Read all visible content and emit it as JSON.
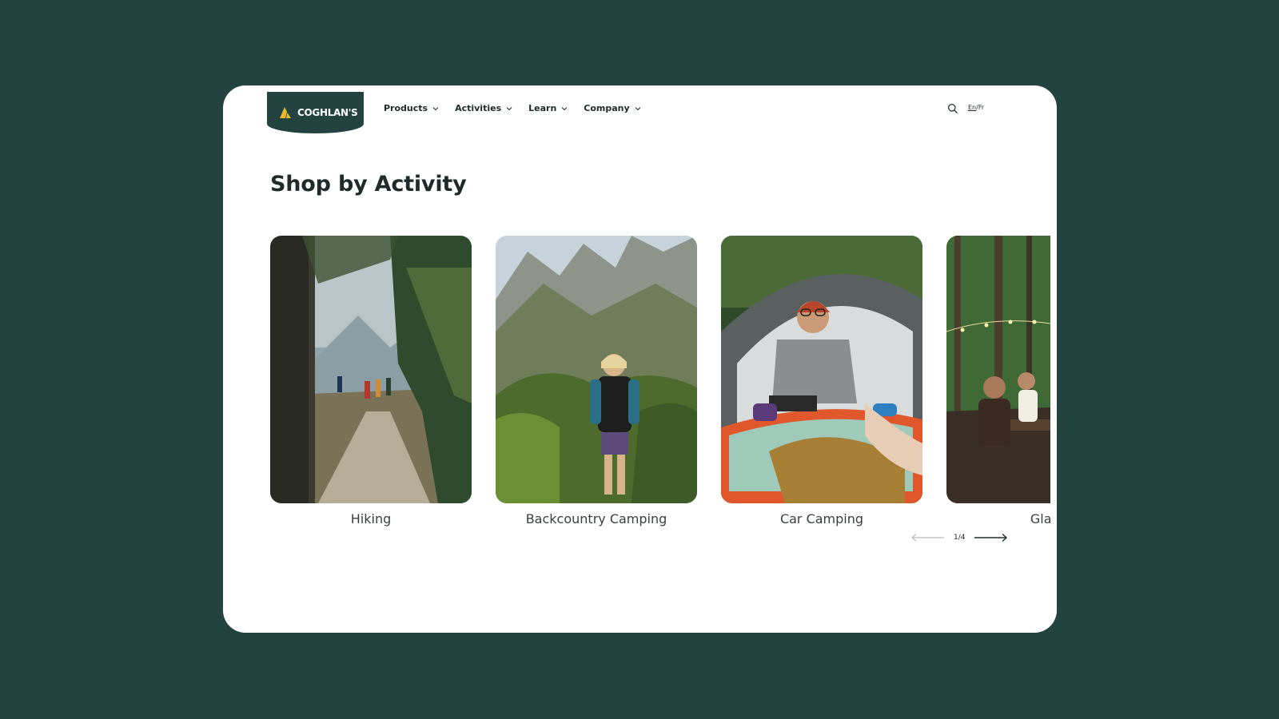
{
  "brand": {
    "name": "COGHLAN'S",
    "colors": {
      "primary": "#234341",
      "accent": "#e9b92c",
      "background": "#234341",
      "surface": "#ffffff"
    }
  },
  "nav": {
    "items": [
      {
        "label": "Products",
        "icon": "chevron-down-icon"
      },
      {
        "label": "Activities",
        "icon": "chevron-down-icon"
      },
      {
        "label": "Learn",
        "icon": "chevron-down-icon"
      },
      {
        "label": "Company",
        "icon": "chevron-down-icon"
      }
    ],
    "search_icon": "search-icon",
    "lang_en": "En",
    "lang_sep": "/",
    "lang_fr": "Fr"
  },
  "section": {
    "title": "Shop by Activity"
  },
  "activities": [
    {
      "label": "Hiking"
    },
    {
      "label": "Backcountry Camping"
    },
    {
      "label": "Car Camping"
    },
    {
      "label": "Glam"
    }
  ],
  "pager": {
    "count": "1/4",
    "prev_icon": "arrow-left-icon",
    "next_icon": "arrow-right-icon"
  }
}
